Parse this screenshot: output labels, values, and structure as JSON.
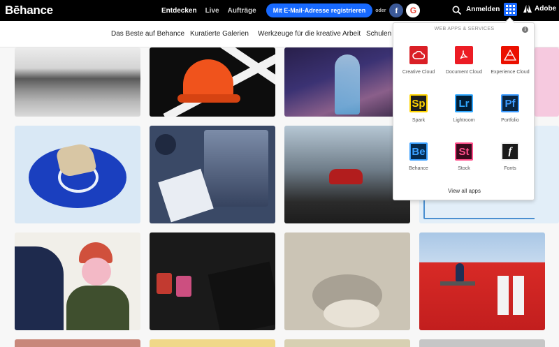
{
  "brand": {
    "logo": "Bēhance"
  },
  "topnav": {
    "links": [
      "Entdecken",
      "Live",
      "Aufträge"
    ],
    "register_label": "Mit E-Mail-Adresse registrieren",
    "or_label": "oder",
    "facebook_glyph": "f",
    "google_glyph": "G",
    "signin_label": "Anmelden",
    "adobe_label": "Adobe"
  },
  "subnav": {
    "items": [
      "Das Beste auf Behance",
      "Kuratierte Galerien",
      "Werkzeuge für die kreative Arbeit",
      "Schulen u"
    ]
  },
  "apps_menu": {
    "title": "WEB APPS & SERVICES",
    "info_glyph": "i",
    "apps": [
      {
        "label": "Creative Cloud",
        "icon": "creative-cloud-icon",
        "bg": "#da1f26",
        "glyph": ""
      },
      {
        "label": "Document Cloud",
        "icon": "document-cloud-icon",
        "bg": "#ec1c24",
        "glyph": ""
      },
      {
        "label": "Experience Cloud",
        "icon": "experience-cloud-icon",
        "bg": "#eb1000",
        "glyph": ""
      },
      {
        "label": "Spark",
        "icon": "spark-icon",
        "bg": "#1e1e1e",
        "glyph": "Sp"
      },
      {
        "label": "Lightroom",
        "icon": "lightroom-icon",
        "bg": "#001e36",
        "glyph": "Lr"
      },
      {
        "label": "Portfolio",
        "icon": "portfolio-icon",
        "bg": "#0a2541",
        "glyph": "Pf"
      },
      {
        "label": "Behance",
        "icon": "behance-app-icon",
        "bg": "#05294c",
        "glyph": "Be"
      },
      {
        "label": "Stock",
        "icon": "stock-icon",
        "bg": "#3a0a1c",
        "glyph": "St"
      },
      {
        "label": "Fonts",
        "icon": "fonts-icon",
        "bg": "#1a1a1a",
        "glyph": "f"
      }
    ],
    "view_all_label": "View all apps"
  },
  "gallery": {
    "tiles": [
      {
        "name": "project-glacier",
        "bg": "linear-gradient(180deg,#e9e9e9 0%,#cfcfcf 40%,#4d4d4d 55%,#9a9a9a 80%,#d0d0d0 100%)"
      },
      {
        "name": "project-orange-cap",
        "bg": "#0d0d0d"
      },
      {
        "name": "project-forest-spirit",
        "bg": "linear-gradient(160deg,#2c2352 0%,#3e3577 40%,#7e5f8f 70%,#3a2b4e 100%)"
      },
      {
        "name": "project-pink-lines",
        "bg": "#f6c9df"
      },
      {
        "name": "project-blue-stone",
        "bg": "#cfe2f3"
      },
      {
        "name": "project-portrait-collage",
        "bg": "#3b4a66"
      },
      {
        "name": "project-car-storm",
        "bg": "linear-gradient(180deg,#c3d3df 0%,#7b8a96 45%,#2f2f2f 80%,#1f1f1f 100%)"
      },
      {
        "name": "project-blueprint",
        "bg": "#e2eef8"
      },
      {
        "name": "project-woman-hat",
        "bg": "#f1efe9"
      },
      {
        "name": "project-chocolate",
        "bg": "#1a1a1a"
      },
      {
        "name": "project-sketch-figure",
        "bg": "#cfc8ba"
      },
      {
        "name": "project-red-building",
        "bg": "linear-gradient(180deg,#a9c7e6 0%,#c5d9ee 40%,#d82a26 41%,#c21e1e 100%)"
      },
      {
        "name": "project-row4-a",
        "bg": "#c8877a"
      },
      {
        "name": "project-row4-b",
        "bg": "#f0d889"
      },
      {
        "name": "project-row4-c",
        "bg": "#d7d0b2"
      },
      {
        "name": "project-row4-d",
        "bg": "#c6c6c6"
      }
    ]
  }
}
